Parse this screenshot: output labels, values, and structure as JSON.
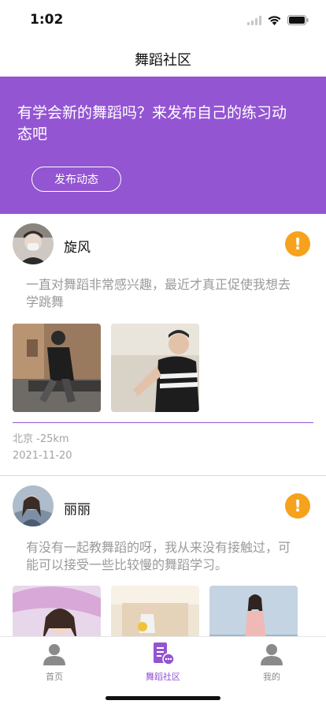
{
  "status": {
    "time": "1:02"
  },
  "nav": {
    "title": "舞蹈社区"
  },
  "banner": {
    "text": "有学会新的舞蹈吗？来发布自己的练习动态吧",
    "button_label": "发布动态",
    "color": "#9355d2"
  },
  "posts": [
    {
      "name": "旋风",
      "text": "一直对舞蹈非常感兴趣，最近才真正促使我想去学跳舞",
      "location": "北京 -25km",
      "date": "2021-11-20",
      "photo_count": 2
    },
    {
      "name": "丽丽",
      "text": "有没有一起教舞蹈的呀，我从来没有接触过，可能可以接受一些比较慢的舞蹈学习。",
      "photo_count": 3
    }
  ],
  "tabbar": {
    "items": [
      {
        "label": "首页",
        "icon": "person-icon",
        "active": false
      },
      {
        "label": "舞蹈社区",
        "icon": "community-icon",
        "active": true
      },
      {
        "label": "我的",
        "icon": "person-icon",
        "active": false
      }
    ],
    "active_color": "#9355d2",
    "inactive_color": "#8a8a8a"
  },
  "colors": {
    "accent": "#9355d2",
    "warning": "#f7a21c"
  }
}
